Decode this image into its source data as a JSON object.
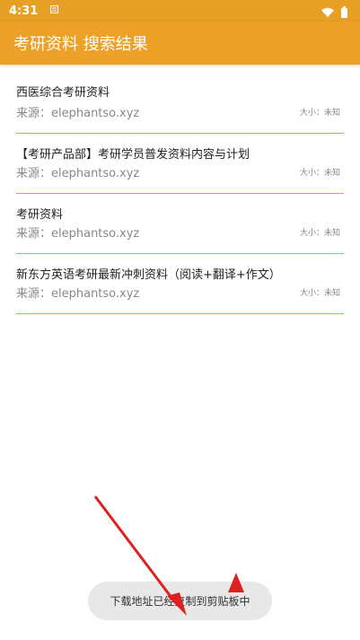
{
  "statusbar": {
    "time": "4:31",
    "notification_icon": "notification-box-icon",
    "wifi_icon": "wifi-icon",
    "battery_icon": "battery-icon"
  },
  "colors": {
    "accent": "#eda128",
    "statusbar": "#e8a024",
    "toast_bg": "#e8e8e8",
    "annotation": "#e02020"
  },
  "appbar": {
    "title": "考研资料 搜索结果"
  },
  "results": [
    {
      "title": "西医综合考研资料",
      "source": "来源：elephantso.xyz",
      "size": "大小：未知"
    },
    {
      "title": "【考研产品部】考研学员普发资料内容与计划",
      "source": "来源：elephantso.xyz",
      "size": "大小：未知"
    },
    {
      "title": "考研资料",
      "source": "来源：elephantso.xyz",
      "size": "大小：未知"
    },
    {
      "title": "新东方英语考研最新冲刺资料（阅读+翻译+作文）",
      "source": "来源：elephantso.xyz",
      "size": "大小：未知"
    }
  ],
  "toast": {
    "message": "下载地址已经复制到剪贴板中"
  }
}
